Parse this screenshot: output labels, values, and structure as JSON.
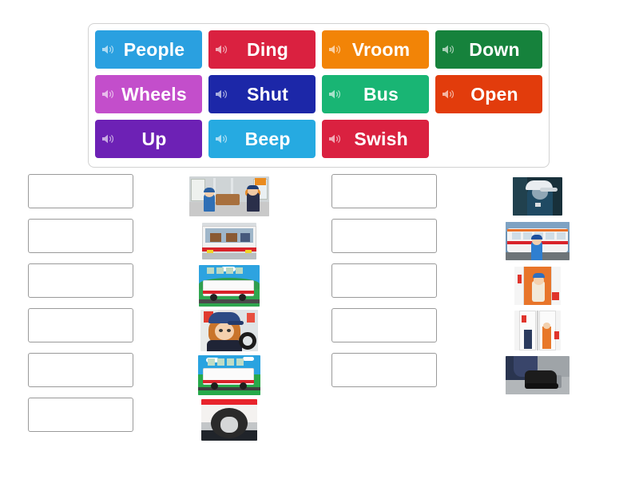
{
  "app": {
    "activity_type": "match-up",
    "background_color": "#ffffff"
  },
  "tile_panel": {
    "name": "word-tile-tray",
    "border_color": "#d2d2d2",
    "tiles": [
      {
        "label": "People",
        "color": "#2aa0e0",
        "icon": "speaker-icon"
      },
      {
        "label": "Ding",
        "color": "#da2140",
        "icon": "speaker-icon"
      },
      {
        "label": "Vroom",
        "color": "#f28407",
        "icon": "speaker-icon"
      },
      {
        "label": "Down",
        "color": "#16823c",
        "icon": "speaker-icon"
      },
      {
        "label": "Wheels",
        "color": "#c34ecb",
        "icon": "speaker-icon"
      },
      {
        "label": "Shut",
        "color": "#1c27a8",
        "icon": "speaker-icon"
      },
      {
        "label": "Bus",
        "color": "#19b574",
        "icon": "speaker-icon"
      },
      {
        "label": "Open",
        "color": "#e23c0c",
        "icon": "speaker-icon"
      },
      {
        "label": "Up",
        "color": "#6d21b5",
        "icon": "speaker-icon"
      },
      {
        "label": "Beep",
        "color": "#26aae1",
        "icon": "speaker-icon"
      },
      {
        "label": "Swish",
        "color": "#da2140",
        "icon": "speaker-icon"
      }
    ]
  },
  "board": {
    "drop_columns": [
      {
        "name": "drop-column-left",
        "slot_count": 6,
        "slots": [
          "",
          "",
          "",
          "",
          "",
          ""
        ]
      },
      {
        "name": "drop-column-right",
        "slot_count": 5,
        "slots": [
          "",
          "",
          "",
          "",
          ""
        ]
      }
    ],
    "image_columns": [
      {
        "name": "image-column-left",
        "images": [
          {
            "alt": "bus interior with passengers and driver",
            "thumb": "t-interior"
          },
          {
            "alt": "bus seen through window with red stripe",
            "thumb": "t-redbus"
          },
          {
            "alt": "white and red bus in countryside",
            "thumb": "t-country"
          },
          {
            "alt": "bus driver close-up at steering wheel",
            "thumb": "t-driver"
          },
          {
            "alt": "bus driving on green field road",
            "thumb": "t-field"
          },
          {
            "alt": "close-up of bus wheel and tire",
            "thumb": "t-wheel"
          }
        ]
      },
      {
        "name": "image-column-right",
        "images": [
          {
            "alt": "conductor in white cap",
            "thumb": "t-cond"
          },
          {
            "alt": "trolleybus with boy boarding",
            "thumb": "t-trolley"
          },
          {
            "alt": "bus door open with passenger",
            "thumb": "t-doorop"
          },
          {
            "alt": "bus doors shut",
            "thumb": "t-doorcl"
          },
          {
            "alt": "foot pressing the pedal",
            "thumb": "t-pedal"
          }
        ]
      }
    ]
  }
}
